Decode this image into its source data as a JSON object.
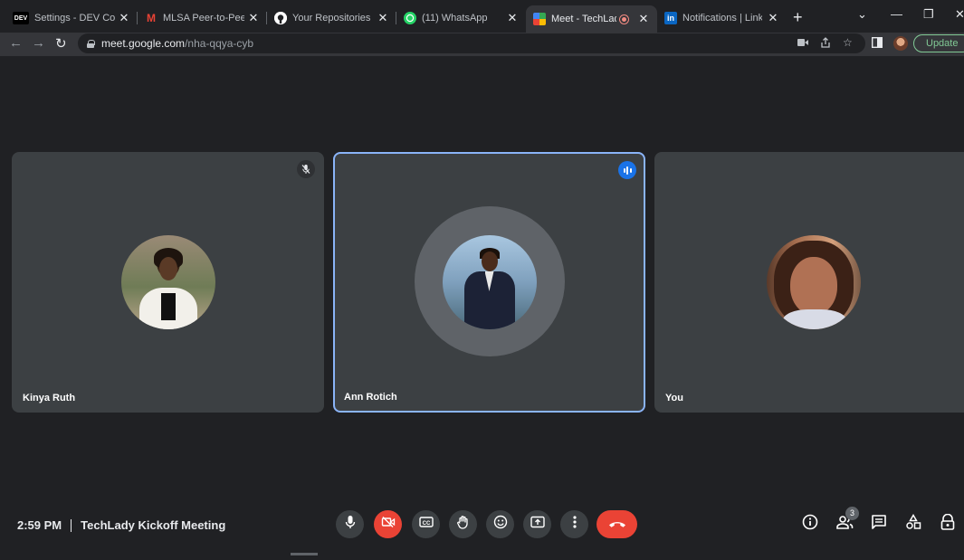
{
  "browser": {
    "tabs": [
      {
        "title": "Settings - DEV Commu",
        "favicon": "dev-logo",
        "active": false
      },
      {
        "title": "MLSA Peer-to-Peer Me",
        "favicon": "gmail-icon",
        "active": false
      },
      {
        "title": "Your Repositories",
        "favicon": "github-icon",
        "active": false
      },
      {
        "title": "(11) WhatsApp",
        "favicon": "whatsapp-icon",
        "active": false
      },
      {
        "title": "Meet - TechLady K",
        "favicon": "google-meet-icon",
        "active": true,
        "recording": true
      },
      {
        "title": "Notifications | LinkedIn",
        "favicon": "linkedin-icon",
        "active": false
      }
    ],
    "favicon_text": {
      "dev": "DEV",
      "gmail": "M",
      "linkedin": "in"
    },
    "url_host": "meet.google.com",
    "url_path": "/nha-qqya-cyb",
    "update_label": "Update",
    "accent_update": "#81c995"
  },
  "meeting": {
    "time": "2:59 PM",
    "title": "TechLady Kickoff Meeting",
    "people_count": "3",
    "participants": [
      {
        "name": "Kinya Ruth",
        "state": "muted"
      },
      {
        "name": "Ann Rotich",
        "state": "speaking"
      },
      {
        "name": "You",
        "state": "normal"
      }
    ]
  },
  "controls": {
    "items": [
      "microphone-icon",
      "camera-off-icon",
      "captions-icon",
      "raise-hand-icon",
      "emoji-icon",
      "present-screen-icon",
      "more-options-icon",
      "end-call-icon"
    ],
    "side": [
      "info-icon",
      "people-icon",
      "chat-icon",
      "activities-icon",
      "host-controls-icon"
    ]
  },
  "colors": {
    "background": "#202124",
    "tile": "#3c4043",
    "speaker_outline": "#8ab4f8",
    "danger": "#ea4335",
    "speaking_badge": "#1a73e8"
  }
}
